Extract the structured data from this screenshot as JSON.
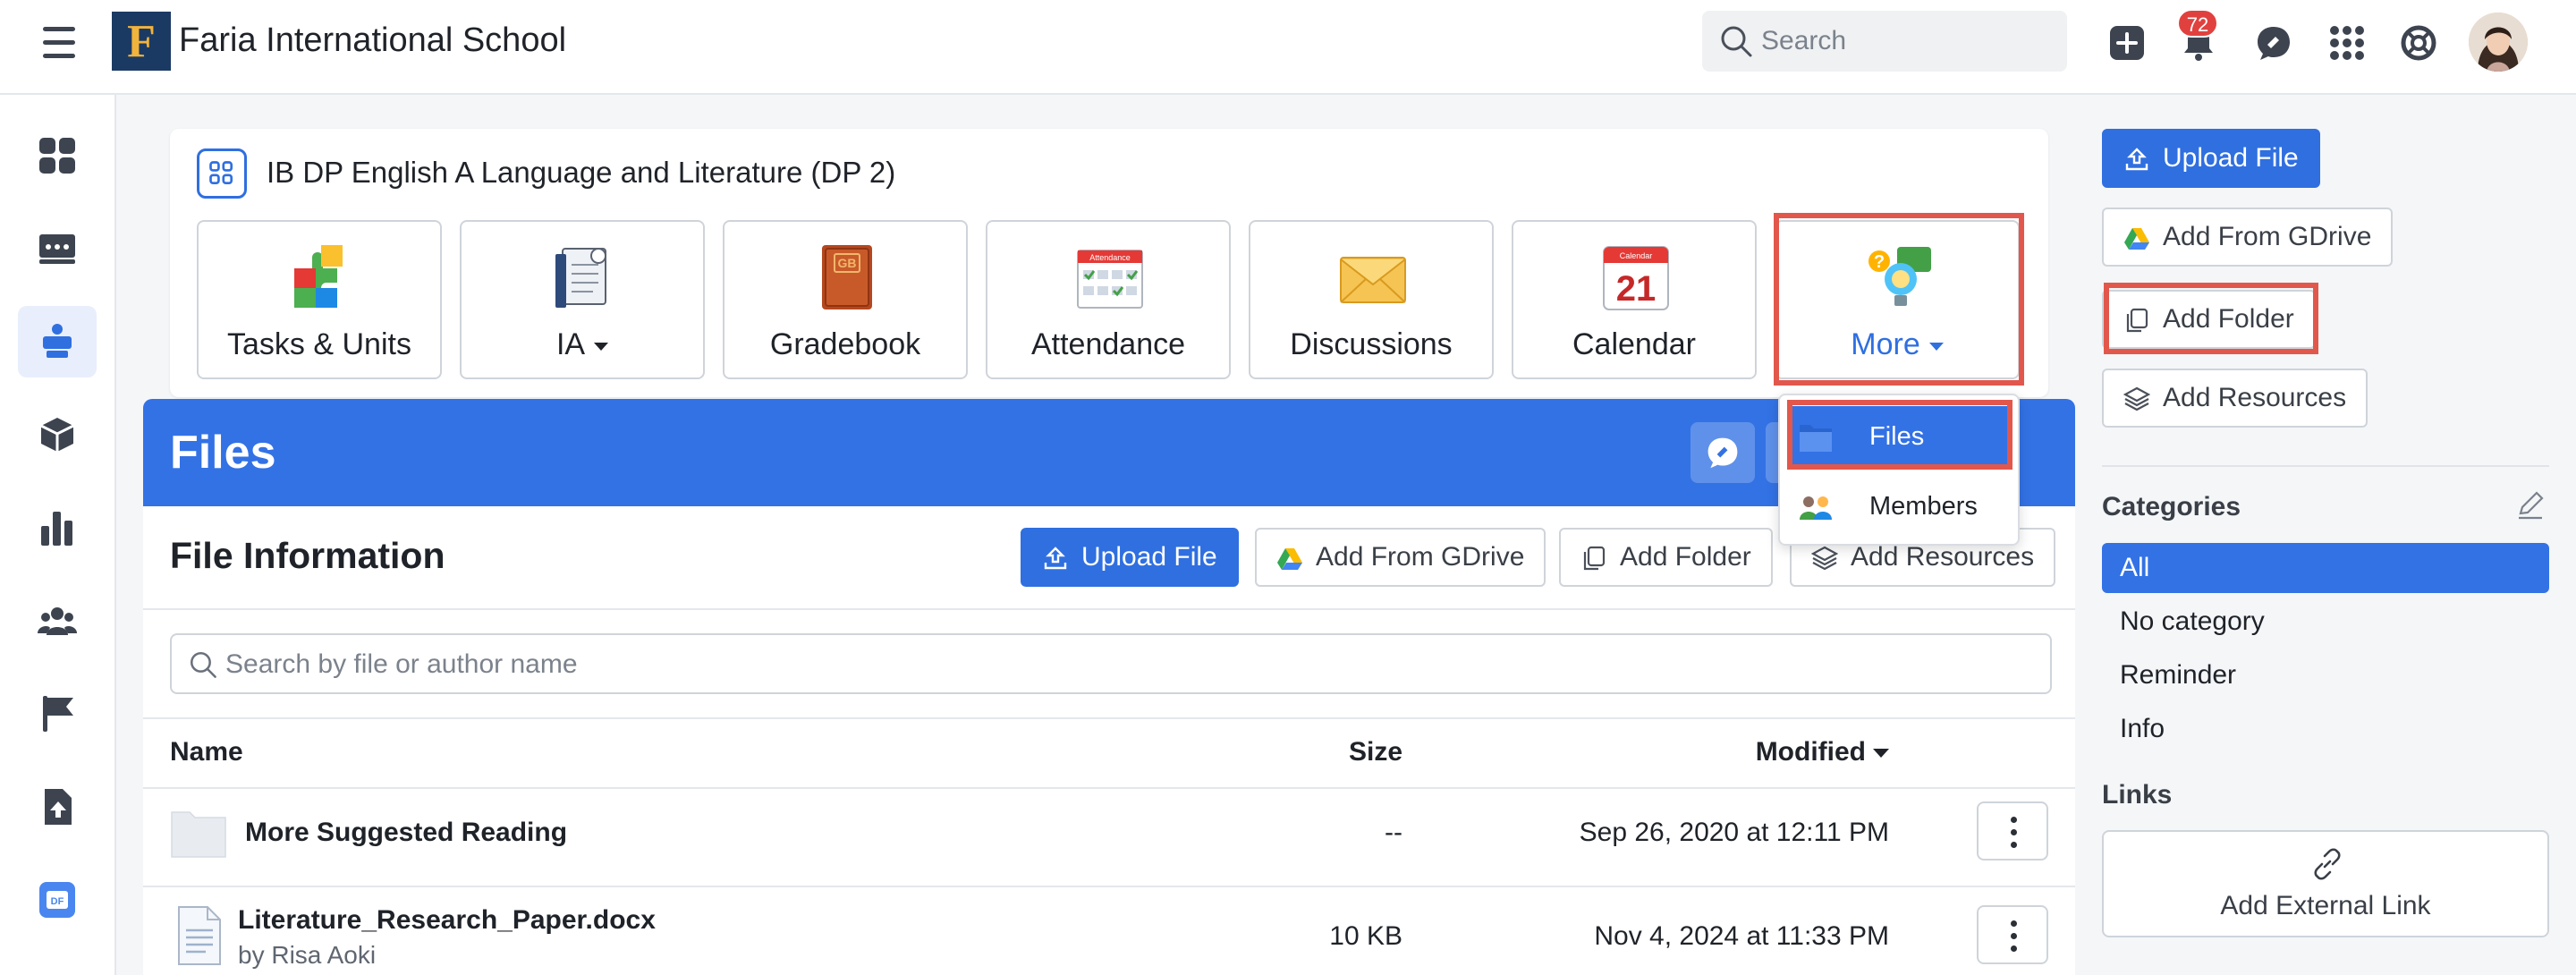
{
  "header": {
    "school_name": "Faria International School",
    "school_logo_letter": "F",
    "search_placeholder": "Search",
    "notification_count": "72"
  },
  "left_nav": {
    "items": [
      {
        "name": "dashboard-icon",
        "active": false
      },
      {
        "name": "classes-icon",
        "active": false
      },
      {
        "name": "teaching-icon",
        "active": true
      },
      {
        "name": "cube-icon",
        "active": false
      },
      {
        "name": "analytics-icon",
        "active": false
      },
      {
        "name": "people-icon",
        "active": false
      },
      {
        "name": "flag-icon",
        "active": false
      },
      {
        "name": "upload-document-icon",
        "active": false
      },
      {
        "name": "df-app-icon",
        "active": false
      }
    ]
  },
  "class_card": {
    "title": "IB DP English A Language and Literature (DP 2)",
    "tools": [
      {
        "label": "Tasks & Units",
        "icon": "puzzle-icon"
      },
      {
        "label": "IA",
        "icon": "ia-document-icon",
        "has_caret": true
      },
      {
        "label": "Gradebook",
        "icon": "gradebook-icon",
        "art_text": "GB"
      },
      {
        "label": "Attendance",
        "icon": "attendance-calendar-icon",
        "art_text": "Attendance"
      },
      {
        "label": "Discussions",
        "icon": "envelope-icon"
      },
      {
        "label": "Calendar",
        "icon": "calendar-icon",
        "art_text": "Calendar",
        "art_number": "21"
      },
      {
        "label": "More",
        "icon": "question-bulb-icon",
        "has_caret": true,
        "highlighted": true
      }
    ]
  },
  "more_dropdown": {
    "items": [
      {
        "label": "Files",
        "icon": "folder-icon",
        "active": true
      },
      {
        "label": "Members",
        "icon": "members-icon",
        "active": false
      }
    ]
  },
  "files": {
    "title": "Files",
    "section_title": "File Information",
    "buttons": {
      "upload": "Upload File",
      "gdrive": "Add From GDrive",
      "folder": "Add Folder",
      "resources": "Add Resources"
    },
    "search_placeholder": "Search by file or author name",
    "columns": {
      "name": "Name",
      "size": "Size",
      "modified": "Modified"
    },
    "rows": [
      {
        "name": "More Suggested Reading",
        "author": "",
        "size": "--",
        "modified": "Sep 26, 2020 at 12:11 PM",
        "type": "folder"
      },
      {
        "name": "Literature_Research_Paper.docx",
        "author": "by Risa Aoki",
        "size": "10 KB",
        "modified": "Nov 4, 2024 at 11:33 PM",
        "type": "document"
      }
    ]
  },
  "right_panel": {
    "upload": "Upload File",
    "gdrive": "Add From GDrive",
    "folder": "Add Folder",
    "resources": "Add Resources",
    "categories_heading": "Categories",
    "categories": [
      "All",
      "No category",
      "Reminder",
      "Info"
    ],
    "active_category": "All",
    "links_heading": "Links",
    "external_link": "Add External Link"
  },
  "colors": {
    "primary": "#2F6FE0",
    "files_header": "#3372E5",
    "highlight": "#E2574C",
    "badge": "#E0413F"
  }
}
